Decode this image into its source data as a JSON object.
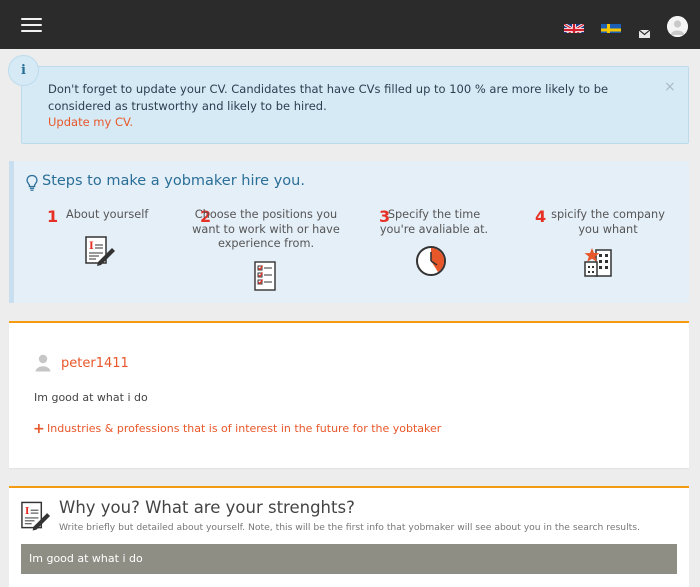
{
  "topbar": {
    "menu_icon": "hamburger-icon",
    "flags": [
      "uk-flag-icon",
      "sweden-flag-icon"
    ],
    "mail_icon": "envelope-icon",
    "avatar_icon": "user-avatar-icon",
    "background_color": "#2b2b2b"
  },
  "alert": {
    "icon_label": "i",
    "message": "Don't forget to update your CV. Candidates that have CVs filled up to 100 % are more likely to be considered as trustworthy and likely to be hired.",
    "link_label": "Update my CV.",
    "close_label": "×",
    "background_color": "#d6eaf5"
  },
  "steps": {
    "title": "Steps to make a yobmaker hire you.",
    "items": [
      {
        "number": "1",
        "label": "About yourself",
        "icon": "cv-document-icon"
      },
      {
        "number": "2",
        "label": "Choose the positions you want to work with or have experience from.",
        "icon": "checklist-icon"
      },
      {
        "number": "3",
        "label": "Specify the time you're avaliable at.",
        "icon": "clock-icon"
      },
      {
        "number": "4",
        "label": "spicify the company you whant",
        "icon": "company-building-icon"
      }
    ],
    "accent_color": "#e63025"
  },
  "profile": {
    "username": "peter1411",
    "bio": "Im good at what i do",
    "industries_label": "Industries & professions that is of interest in the future for the yobtaker",
    "accent_color": "#e8572a"
  },
  "why_you": {
    "title": "Why you? What are your strenghts?",
    "subtitle": "Write briefly but detailed about yourself. Note, this will be the first info that yobmaker will see about you in the search results.",
    "text": "Im good at what i do"
  }
}
